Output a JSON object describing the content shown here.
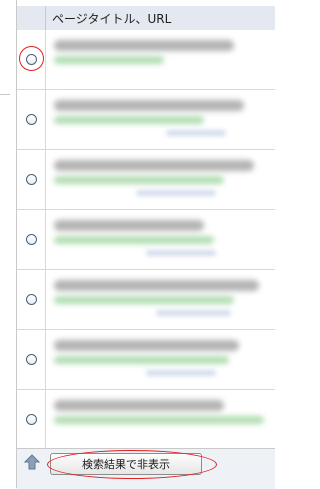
{
  "header": {
    "title": "ページタイトル、URL"
  },
  "rows": [
    {
      "selected": false
    },
    {
      "selected": false
    },
    {
      "selected": false
    },
    {
      "selected": false
    },
    {
      "selected": false
    },
    {
      "selected": false
    },
    {
      "selected": false
    }
  ],
  "footer": {
    "hide_button_label": "検索結果で非表示"
  },
  "colors": {
    "header_bg": "#e4e8f0",
    "highlight": "#e02020",
    "url_green": "#9ed59e"
  }
}
